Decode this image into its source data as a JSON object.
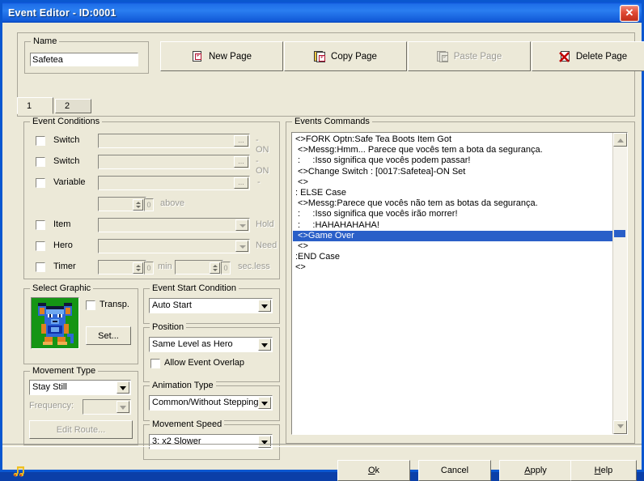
{
  "window": {
    "title": "Event Editor - ID:0001",
    "close_label": "✕",
    "accent_title_bar": "#1e6ee8",
    "face_color": "#ece9d8",
    "selection_color": "#2a5fc8"
  },
  "name_group": {
    "label": "Name",
    "value": "Safetea",
    "placeholder": ""
  },
  "page_buttons": [
    {
      "label": "New Page",
      "icon": "new-page-icon",
      "enabled": true
    },
    {
      "label": "Copy Page",
      "icon": "copy-page-icon",
      "enabled": true
    },
    {
      "label": "Paste Page",
      "icon": "paste-page-icon",
      "enabled": false
    },
    {
      "label": "Delete Page",
      "icon": "delete-page-icon",
      "enabled": true
    }
  ],
  "tabs": [
    {
      "label": "1",
      "selected": true
    },
    {
      "label": "2",
      "selected": false
    }
  ],
  "event_conditions": {
    "label": "Event Conditions",
    "rows": [
      {
        "name": "switch-1",
        "label": "Switch",
        "checked": false,
        "value": "",
        "suffix": "- ON"
      },
      {
        "name": "switch-2",
        "label": "Switch",
        "checked": false,
        "value": "",
        "suffix": "- ON"
      },
      {
        "name": "variable",
        "label": "Variable",
        "checked": false,
        "value": "",
        "suffix": "-"
      },
      {
        "name": "var-above",
        "label": "",
        "checked": null,
        "value": "",
        "suffix": "above",
        "spin_value": "0"
      },
      {
        "name": "item",
        "label": "Item",
        "checked": false,
        "value": "",
        "suffix": "Hold"
      },
      {
        "name": "hero",
        "label": "Hero",
        "checked": false,
        "value": "",
        "suffix": "Need"
      },
      {
        "name": "timer",
        "label": "Timer",
        "checked": false,
        "value": "",
        "suffix_min": "min",
        "suffix_sec": "sec.less",
        "spin_min": "0",
        "spin_sec": "0"
      }
    ]
  },
  "select_graphic": {
    "label": "Select Graphic",
    "transparent_label": "Transp.",
    "transparent_checked": false,
    "set_button": "Set...",
    "sprite_background": "#159515",
    "sprite_colors": {
      "blue_dark": "#1030a8",
      "blue_mid": "#2f68d8",
      "blue_light": "#6fa8f0",
      "orange": "#e08020",
      "orange_light": "#f0b050",
      "outline": "#101838",
      "white": "#ffffff"
    }
  },
  "movement_type": {
    "label": "Movement Type",
    "value": "Stay Still",
    "frequency_label": "Frequency:",
    "frequency_value": "",
    "frequency_enabled": false,
    "edit_route_label": "Edit Route...",
    "edit_route_enabled": false
  },
  "event_start_condition": {
    "label": "Event Start Condition",
    "value": "Auto Start"
  },
  "position": {
    "label": "Position",
    "value": "Same Level as Hero",
    "overlap_label": "Allow Event Overlap",
    "overlap_checked": false
  },
  "animation_type": {
    "label": "Animation Type",
    "value": "Common/Without Stepping"
  },
  "movement_speed": {
    "label": "Movement Speed",
    "value": "3: x2 Slower"
  },
  "events_commands": {
    "label": "Events Commands",
    "lines": [
      {
        "text": "<>FORK Optn:Safe Tea Boots Item Got",
        "selected": false
      },
      {
        "text": " <>Messg:Hmm... Parece que vocês tem a bota da segurança.",
        "selected": false
      },
      {
        "text": " :     :Isso significa que vocês podem passar!",
        "selected": false
      },
      {
        "text": " <>Change Switch : [0017:Safetea]-ON Set",
        "selected": false
      },
      {
        "text": " <>",
        "selected": false
      },
      {
        "text": ": ELSE Case",
        "selected": false
      },
      {
        "text": " <>Messg:Parece que vocês não tem as botas da segurança.",
        "selected": false
      },
      {
        "text": " :     :Isso significa que vocês irão morrer!",
        "selected": false
      },
      {
        "text": " :     :HAHAHAHAHA!",
        "selected": false
      },
      {
        "text": " <>Game Over",
        "selected": true
      },
      {
        "text": " <>",
        "selected": false
      },
      {
        "text": ":END Case",
        "selected": false
      },
      {
        "text": "<>",
        "selected": false
      }
    ],
    "scroll_up_icon": "scroll-up-icon",
    "scroll_down_icon": "scroll-down-icon"
  },
  "bottom_bar": {
    "music_icon": "music-note-icon",
    "buttons": [
      {
        "label": "Ok",
        "mnemonic": "O"
      },
      {
        "label": "Cancel",
        "mnemonic": ""
      },
      {
        "label": "Apply",
        "mnemonic": "A"
      },
      {
        "label": "Help",
        "mnemonic": "H"
      }
    ]
  }
}
